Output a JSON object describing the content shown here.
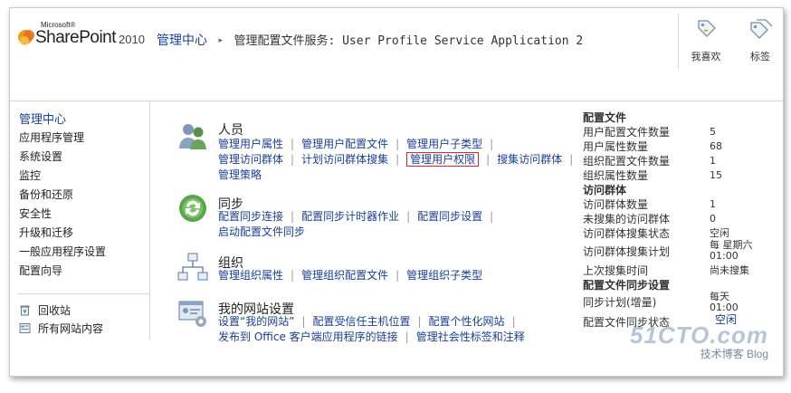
{
  "logo": {
    "ms": "Microsoft®",
    "brand": "SharePoint",
    "version": "2010"
  },
  "breadcrumb": {
    "home": "管理中心",
    "separator": "▸",
    "page": "管理配置文件服务: User Profile Service Application 2"
  },
  "ribbon": {
    "like_label": "我喜欢",
    "tags_label": "标签"
  },
  "leftnav": {
    "header": "管理中心",
    "items": [
      "应用程序管理",
      "系统设置",
      "监控",
      "备份和还原",
      "安全性",
      "升级和迁移",
      "一般应用程序设置",
      "配置向导"
    ],
    "footer": [
      "回收站",
      "所有网站内容"
    ]
  },
  "groups": {
    "people": {
      "title": "人员",
      "links": [
        "管理用户属性",
        "管理用户配置文件",
        "管理用户子类型",
        "管理访问群体",
        "计划访问群体搜集",
        "管理用户权限",
        "搜集访问群体",
        "管理策略"
      ]
    },
    "sync": {
      "title": "同步",
      "links": [
        "配置同步连接",
        "配置同步计时器作业",
        "配置同步设置",
        "启动配置文件同步"
      ]
    },
    "org": {
      "title": "组织",
      "links": [
        "管理组织属性",
        "管理组织配置文件",
        "管理组织子类型"
      ]
    },
    "mysite": {
      "title": "我的网站设置",
      "links": [
        "设置“我的网站”",
        "配置受信任主机位置",
        "配置个性化网站",
        "发布到 Office 客户端应用程序的链接",
        "管理社会性标签和注释"
      ]
    }
  },
  "stats": {
    "profiles_header": "配置文件",
    "profiles": [
      {
        "label": "用户配置文件数量",
        "value": "5"
      },
      {
        "label": "用户属性数量",
        "value": "68"
      },
      {
        "label": "组织配置文件数量",
        "value": "1"
      },
      {
        "label": "组织属性数量",
        "value": "15"
      }
    ],
    "audiences_header": "访问群体",
    "audiences": [
      {
        "label": "访问群体数量",
        "value": "1"
      },
      {
        "label": "未搜集的访问群体",
        "value": "0"
      },
      {
        "label": "访问群体搜集状态",
        "value": "空闲"
      },
      {
        "label": "访问群体搜集计划",
        "value": "每 星期六",
        "value2": "01:00"
      },
      {
        "label": "上次搜集时间",
        "value": "尚未搜集"
      }
    ],
    "sync_header": "配置文件同步设置",
    "sync": [
      {
        "label": "同步计划(增量)",
        "value": "每天",
        "value2": "01:00"
      },
      {
        "label": "配置文件同步状态",
        "value": "空闲"
      }
    ]
  },
  "watermark": {
    "site": "51CTO.com",
    "tagline": "技术博客",
    "blog": "Blog"
  },
  "colors": {
    "link": "#1b3f94",
    "highlight_border": "#d62b2b"
  }
}
